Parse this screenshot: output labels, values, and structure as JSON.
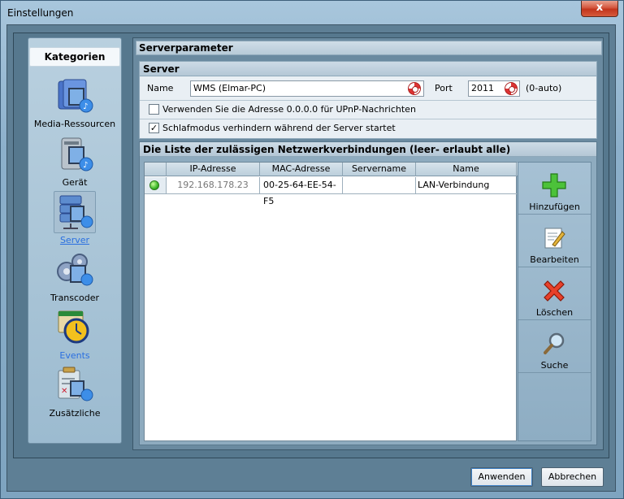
{
  "window": {
    "title": "Einstellungen",
    "close_label": "x"
  },
  "categories": {
    "header": "Kategorien",
    "items": [
      {
        "label": "Media-Ressourcen",
        "icon": "media-resources-icon"
      },
      {
        "label": "Gerät",
        "icon": "device-icon"
      },
      {
        "label": "Server",
        "icon": "server-icon",
        "selected": true
      },
      {
        "label": "Transcoder",
        "icon": "transcoder-icon"
      },
      {
        "label": "Events",
        "icon": "events-icon"
      },
      {
        "label": "Zusätzliche",
        "icon": "additional-icon"
      }
    ]
  },
  "serverparameter": {
    "title": "Serverparameter",
    "server": {
      "title": "Server",
      "name_label": "Name",
      "name_value": "WMS (Elmar-PC)",
      "port_label": "Port",
      "port_value": "2011",
      "port_hint": "(0-auto)",
      "upnp_label": "Verwenden Sie die Adresse 0.0.0.0 für UPnP-Nachrichten",
      "upnp_checked": false,
      "sleep_label": "Schlafmodus verhindern während der Server startet",
      "sleep_checked": true,
      "check_mark": "✓"
    },
    "network": {
      "title": "Die Liste der zulässigen Netzwerkverbindungen (leer- erlaubt alle)",
      "columns": [
        "",
        "IP-Adresse",
        "MAC-Adresse",
        "Servername",
        "Name"
      ],
      "rows": [
        {
          "status": "active",
          "ip": "192.168.178.23",
          "mac": "00-25-64-EE-54-F5",
          "servername": "",
          "name": "LAN-Verbindung"
        }
      ],
      "actions": [
        {
          "label": "Hinzufügen",
          "icon": "add-icon"
        },
        {
          "label": "Bearbeiten",
          "icon": "edit-icon"
        },
        {
          "label": "Löschen",
          "icon": "delete-icon"
        },
        {
          "label": "Suche",
          "icon": "search-icon"
        }
      ]
    }
  },
  "footer": {
    "apply_label": "Anwenden",
    "cancel_label": "Abbrechen"
  },
  "colors": {
    "accent_link": "#2a6fe0",
    "panel_bg": "#56788e",
    "close_red": "#c2351c"
  }
}
